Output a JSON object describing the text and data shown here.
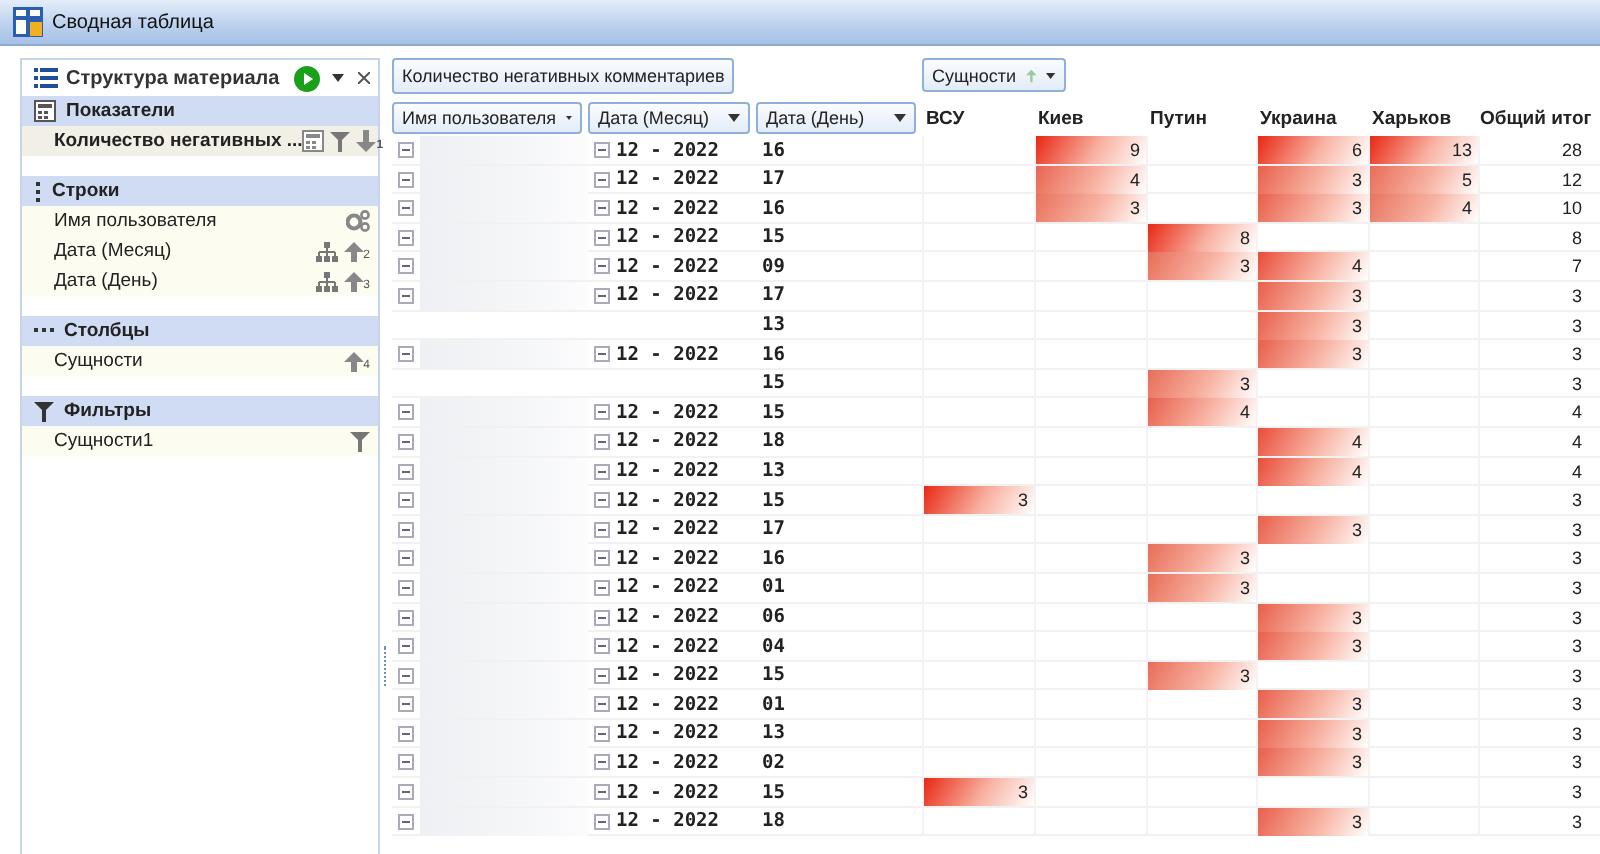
{
  "window": {
    "title": "Сводная таблица"
  },
  "field_list": {
    "title": "Структура материала",
    "sections": [
      {
        "kind": "measures",
        "title": "Показатели",
        "items": [
          {
            "label": "Количество негативных ...",
            "kind": "measure",
            "sort_index": "1"
          }
        ]
      },
      {
        "kind": "rows",
        "title": "Строки",
        "items": [
          {
            "label": "Имя пользователя",
            "kind": "grouped"
          },
          {
            "label": "Дата (Месяц)",
            "kind": "hierarchy",
            "sort_index": "2"
          },
          {
            "label": "Дата (День)",
            "kind": "hierarchy",
            "sort_index": "3"
          }
        ]
      },
      {
        "kind": "columns",
        "title": "Столбцы",
        "items": [
          {
            "label": "Сущности",
            "kind": "sorted",
            "sort_index": "4"
          }
        ]
      },
      {
        "kind": "filters",
        "title": "Фильтры",
        "items": [
          {
            "label": "Сущности1",
            "kind": "filter"
          }
        ]
      }
    ]
  },
  "pivot": {
    "data_field": "Количество негативных комментариев",
    "column_field": "Сущности",
    "row_headers": [
      "Имя пользователя",
      "Дата (Месяц)",
      "Дата (День)"
    ],
    "columns": [
      "ВСУ",
      "Киев",
      "Путин",
      "Украина",
      "Харьков",
      "Общий итог"
    ],
    "rows": [
      {
        "user": true,
        "month": "12 - 2022",
        "day": "16",
        "values": {
          "col_2": "9",
          "col_4": "6",
          "col_5": "13"
        },
        "total": "28"
      },
      {
        "user": true,
        "month": "12 - 2022",
        "day": "17",
        "values": {
          "col_2": "4",
          "col_4": "3",
          "col_5": "5"
        },
        "total": "12"
      },
      {
        "user": true,
        "month": "12 - 2022",
        "day": "16",
        "values": {
          "col_2": "3",
          "col_4": "3",
          "col_5": "4"
        },
        "total": "10"
      },
      {
        "user": true,
        "month": "12 - 2022",
        "day": "15",
        "values": {
          "col_3": "8"
        },
        "total": "8"
      },
      {
        "user": true,
        "month": "12 - 2022",
        "day": "09",
        "values": {
          "col_3": "3",
          "col_4": "4"
        },
        "total": "7"
      },
      {
        "user": true,
        "month": "12 - 2022",
        "day": "17",
        "values": {
          "col_4": "3"
        },
        "total": "3"
      },
      {
        "user": false,
        "day": "13",
        "values": {
          "col_4": "3"
        },
        "total": "3"
      },
      {
        "user": true,
        "month": "12 - 2022",
        "day": "16",
        "values": {
          "col_4": "3"
        },
        "total": "3"
      },
      {
        "user": false,
        "day": "15",
        "values": {
          "col_3": "3"
        },
        "total": "3"
      },
      {
        "user": true,
        "month": "12 - 2022",
        "day": "15",
        "values": {
          "col_3": "4"
        },
        "total": "4"
      },
      {
        "user": true,
        "month": "12 - 2022",
        "day": "18",
        "values": {
          "col_4": "4"
        },
        "total": "4"
      },
      {
        "user": true,
        "month": "12 - 2022",
        "day": "13",
        "values": {
          "col_4": "4"
        },
        "total": "4"
      },
      {
        "user": true,
        "month": "12 - 2022",
        "day": "15",
        "values": {
          "col_1": "3"
        },
        "total": "3"
      },
      {
        "user": true,
        "month": "12 - 2022",
        "day": "17",
        "values": {
          "col_4": "3"
        },
        "total": "3"
      },
      {
        "user": true,
        "month": "12 - 2022",
        "day": "16",
        "values": {
          "col_3": "3"
        },
        "total": "3"
      },
      {
        "user": true,
        "month": "12 - 2022",
        "day": "01",
        "values": {
          "col_3": "3"
        },
        "total": "3"
      },
      {
        "user": true,
        "month": "12 - 2022",
        "day": "06",
        "values": {
          "col_4": "3"
        },
        "total": "3"
      },
      {
        "user": true,
        "month": "12 - 2022",
        "day": "04",
        "values": {
          "col_4": "3"
        },
        "total": "3"
      },
      {
        "user": true,
        "month": "12 - 2022",
        "day": "15",
        "values": {
          "col_3": "3"
        },
        "total": "3"
      },
      {
        "user": true,
        "month": "12 - 2022",
        "day": "01",
        "values": {
          "col_4": "3"
        },
        "total": "3"
      },
      {
        "user": true,
        "month": "12 - 2022",
        "day": "13",
        "values": {
          "col_4": "3"
        },
        "total": "3"
      },
      {
        "user": true,
        "month": "12 - 2022",
        "day": "02",
        "values": {
          "col_4": "3"
        },
        "total": "3"
      },
      {
        "user": true,
        "month": "12 - 2022",
        "day": "15",
        "values": {
          "col_1": "3"
        },
        "total": "3"
      },
      {
        "user": true,
        "month": "12 - 2022",
        "day": "18",
        "values": {
          "col_4": "3"
        },
        "total": "3"
      }
    ]
  }
}
